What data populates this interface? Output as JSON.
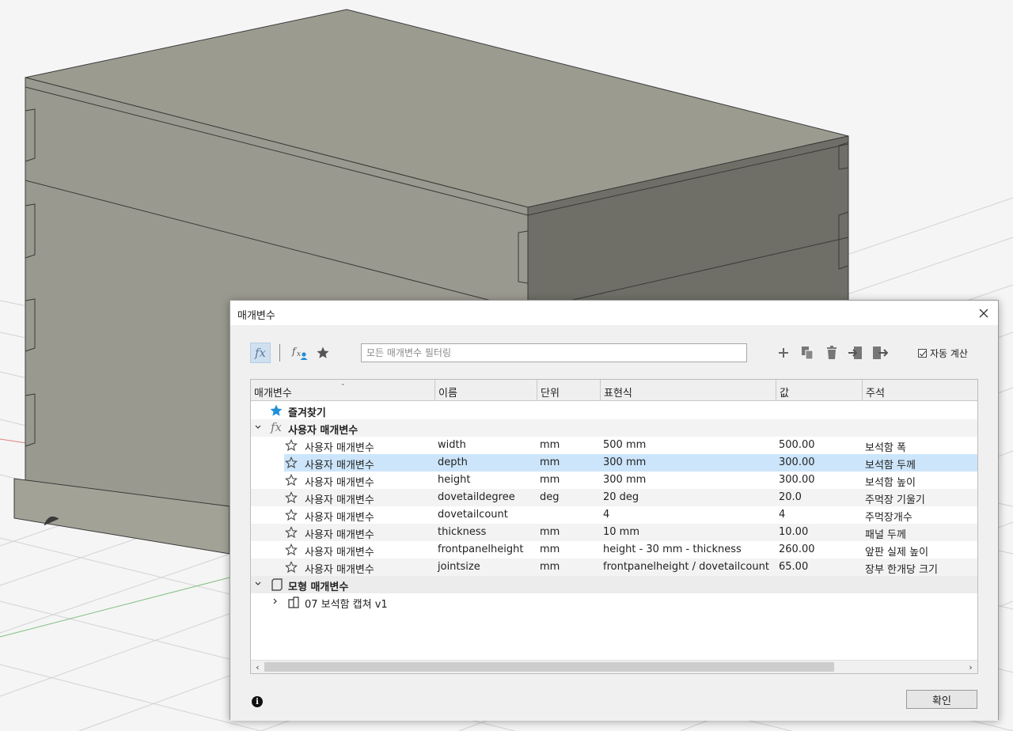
{
  "dialog": {
    "title": "매개변수",
    "filter_placeholder": "모든 매개변수 필터링",
    "auto_calc_label": "자동 계산",
    "ok_label": "확인"
  },
  "columns": [
    "매개변수",
    "이름",
    "단위",
    "표현식",
    "값",
    "주석"
  ],
  "groups": {
    "favorites": "즐겨찾기",
    "user_params": "사용자 매개변수",
    "model_params": "모형 매개변수",
    "model_item": "07 보석함 캡쳐 v1"
  },
  "rows": [
    {
      "type": "사용자 매개변수",
      "name": "width",
      "unit": "mm",
      "expr": "500 mm",
      "value": "500.00",
      "comment": "보석함 폭"
    },
    {
      "type": "사용자 매개변수",
      "name": "depth",
      "unit": "mm",
      "expr": "300 mm",
      "value": "300.00",
      "comment": "보석함 두께"
    },
    {
      "type": "사용자 매개변수",
      "name": "height",
      "unit": "mm",
      "expr": "300 mm",
      "value": "300.00",
      "comment": "보석함 높이"
    },
    {
      "type": "사용자 매개변수",
      "name": "dovetaildegree",
      "unit": "deg",
      "expr": "20 deg",
      "value": "20.0",
      "comment": "주먹장 기울기"
    },
    {
      "type": "사용자 매개변수",
      "name": "dovetailcount",
      "unit": "",
      "expr": "4",
      "value": "4",
      "comment": "주먹장개수"
    },
    {
      "type": "사용자 매개변수",
      "name": "thickness",
      "unit": "mm",
      "expr": "10 mm",
      "value": "10.00",
      "comment": "패널 두께"
    },
    {
      "type": "사용자 매개변수",
      "name": "frontpanelheight",
      "unit": "mm",
      "expr": "height - 30 mm - thickness",
      "value": "260.00",
      "comment": "앞판 실제 높이"
    },
    {
      "type": "사용자 매개변수",
      "name": "jointsize",
      "unit": "mm",
      "expr": "frontpanelheight / dovetailcount",
      "value": "65.00",
      "comment": "장부 한개당 크기"
    }
  ],
  "selected_row": 1,
  "colors": {
    "accent": "#1e90d6",
    "selection": "#cce5fb",
    "model_body": "#9b9a90",
    "model_side": "#6e6e68"
  }
}
